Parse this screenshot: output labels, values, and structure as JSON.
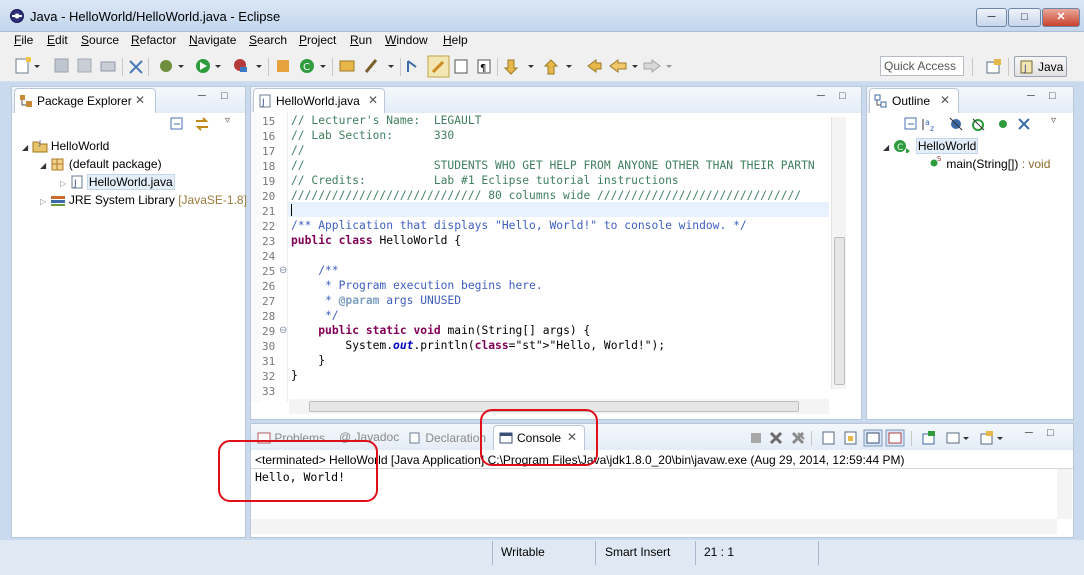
{
  "window": {
    "title": "Java - HelloWorld/HelloWorld.java - Eclipse"
  },
  "menu": [
    "File",
    "Edit",
    "Source",
    "Refactor",
    "Navigate",
    "Search",
    "Project",
    "Run",
    "Window",
    "Help"
  ],
  "menu_mnemonic_index": [
    0,
    0,
    0,
    0,
    0,
    0,
    0,
    0,
    0,
    0
  ],
  "toolbar": {
    "quick_access": "Quick Access",
    "perspective": "Java"
  },
  "package_explorer": {
    "tab": "Package Explorer",
    "project": "HelloWorld",
    "package": "(default package)",
    "file": "HelloWorld.java",
    "library": "JRE System Library",
    "library_version": "[JavaSE-1.8]"
  },
  "editor": {
    "tab": "HelloWorld.java",
    "line_numbers": [
      "15",
      "16",
      "17",
      "18",
      "19",
      "20",
      "21",
      "22",
      "23",
      "24",
      "25",
      "26",
      "27",
      "28",
      "29",
      "30",
      "31",
      "32",
      "33"
    ],
    "lines": [
      "// Lecturer's Name:  LEGAULT",
      "// Lab Section:      330",
      "//",
      "//                   STUDENTS WHO GET HELP FROM ANYONE OTHER THAN THEIR PARTN",
      "// Credits:          Lab #1 Eclipse tutorial instructions",
      "//////////////////////////// 80 columns wide //////////////////////////////",
      "",
      "/** Application that displays \"Hello, World!\" to console window. */",
      "public class HelloWorld {",
      "",
      "    /**",
      "     * Program execution begins here.",
      "     * @param args UNUSED",
      "     */",
      "    public static void main(String[] args) {",
      "        System.out.println(\"Hello, World!\");",
      "    }",
      "}",
      ""
    ]
  },
  "outline": {
    "tab": "Outline",
    "class": "HelloWorld",
    "method": "main(String[])",
    "method_type": ": void"
  },
  "bottom_tabs": {
    "problems": "Problems",
    "javadoc": "@ Javadoc",
    "declaration": "Declaration",
    "console": "Console"
  },
  "console": {
    "header": "<terminated> HelloWorld [Java Application] C:\\Program Files\\Java\\jdk1.8.0_20\\bin\\javaw.exe (Aug 29, 2014, 12:59:44 PM)",
    "output": "Hello, World!"
  },
  "status": {
    "writable": "Writable",
    "insert_mode": "Smart Insert",
    "position": "21 : 1"
  },
  "colors": {
    "highlight_ring": "#e0101a",
    "keyword": "#7f0055",
    "comment": "#3f7f5f",
    "javadoc": "#3f5fbf",
    "string": "#2a00ff"
  }
}
